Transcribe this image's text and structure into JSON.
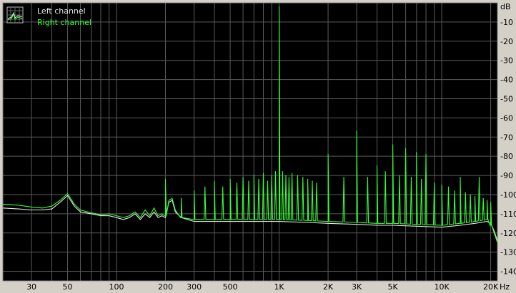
{
  "chart_data": {
    "type": "line",
    "title": "",
    "xlabel": "Hz",
    "ylabel": "dB",
    "x_scale": "log",
    "xlim": [
      20,
      22000
    ],
    "ylim": [
      -145,
      0
    ],
    "grid": true,
    "legend_position": "top-left",
    "x_ticks": [
      {
        "value": 30,
        "label": "30"
      },
      {
        "value": 50,
        "label": "50"
      },
      {
        "value": 100,
        "label": "100"
      },
      {
        "value": 200,
        "label": "200"
      },
      {
        "value": 300,
        "label": "300"
      },
      {
        "value": 500,
        "label": "500"
      },
      {
        "value": 1000,
        "label": "1K"
      },
      {
        "value": 2000,
        "label": "2K"
      },
      {
        "value": 3000,
        "label": "3K"
      },
      {
        "value": 5000,
        "label": "5K"
      },
      {
        "value": 10000,
        "label": "10K"
      },
      {
        "value": 20000,
        "label": "20K"
      }
    ],
    "y_ticks": [
      -10,
      -20,
      -30,
      -40,
      -50,
      -60,
      -70,
      -80,
      -90,
      -100,
      -110,
      -120,
      -130,
      -140
    ],
    "series": [
      {
        "name": "Left channel",
        "color": "#e8e8e8",
        "points": [
          [
            20,
            -107
          ],
          [
            25,
            -107.5
          ],
          [
            30,
            -108
          ],
          [
            35,
            -108
          ],
          [
            40,
            -107.5
          ],
          [
            45,
            -104
          ],
          [
            50,
            -100.5
          ],
          [
            55,
            -106
          ],
          [
            60,
            -109
          ],
          [
            70,
            -110
          ],
          [
            80,
            -111
          ],
          [
            90,
            -111
          ],
          [
            100,
            -112
          ],
          [
            110,
            -113
          ],
          [
            120,
            -112
          ],
          [
            130,
            -110
          ],
          [
            140,
            -113
          ],
          [
            150,
            -110
          ],
          [
            160,
            -112
          ],
          [
            170,
            -109
          ],
          [
            180,
            -112
          ],
          [
            190,
            -111
          ],
          [
            200,
            -112
          ],
          [
            210,
            -104
          ],
          [
            220,
            -103
          ],
          [
            230,
            -109
          ],
          [
            250,
            -112
          ],
          [
            300,
            -114
          ],
          [
            400,
            -114
          ],
          [
            500,
            -114
          ],
          [
            700,
            -114
          ],
          [
            1000,
            -114
          ],
          [
            1500,
            -114.5
          ],
          [
            2000,
            -115
          ],
          [
            3000,
            -115.5
          ],
          [
            4000,
            -116
          ],
          [
            5000,
            -116
          ],
          [
            7000,
            -116.5
          ],
          [
            10000,
            -117
          ],
          [
            13000,
            -116
          ],
          [
            16000,
            -115
          ],
          [
            19000,
            -114
          ],
          [
            20000,
            -115
          ],
          [
            21000,
            -119
          ],
          [
            22000,
            -124
          ]
        ]
      },
      {
        "name": "Right channel",
        "color": "#33ff33",
        "points": [
          [
            20,
            -105
          ],
          [
            25,
            -105.5
          ],
          [
            30,
            -106.5
          ],
          [
            35,
            -107
          ],
          [
            40,
            -106
          ],
          [
            45,
            -103
          ],
          [
            50,
            -99.5
          ],
          [
            55,
            -105
          ],
          [
            60,
            -108
          ],
          [
            70,
            -109.5
          ],
          [
            80,
            -110.5
          ],
          [
            90,
            -110
          ],
          [
            100,
            -111
          ],
          [
            110,
            -112
          ],
          [
            120,
            -111
          ],
          [
            130,
            -109
          ],
          [
            140,
            -112
          ],
          [
            150,
            -108
          ],
          [
            160,
            -111
          ],
          [
            170,
            -107
          ],
          [
            180,
            -111
          ],
          [
            190,
            -110
          ],
          [
            200,
            -111
          ],
          [
            210,
            -103
          ],
          [
            220,
            -102
          ],
          [
            230,
            -108
          ],
          [
            250,
            -112
          ],
          [
            300,
            -113
          ],
          [
            400,
            -113
          ],
          [
            500,
            -113
          ],
          [
            700,
            -113
          ],
          [
            1000,
            -113
          ],
          [
            1500,
            -113.5
          ],
          [
            2000,
            -114
          ],
          [
            3000,
            -114.5
          ],
          [
            4000,
            -115
          ],
          [
            5000,
            -115
          ],
          [
            7000,
            -115.5
          ],
          [
            10000,
            -116
          ],
          [
            13000,
            -115
          ],
          [
            16000,
            -114
          ],
          [
            19000,
            -113
          ],
          [
            20000,
            -116
          ],
          [
            21000,
            -120
          ],
          [
            22000,
            -125
          ]
        ],
        "peaks": [
          [
            200,
            -92
          ],
          [
            250,
            -102
          ],
          [
            300,
            -98
          ],
          [
            350,
            -96
          ],
          [
            400,
            -93
          ],
          [
            450,
            -96
          ],
          [
            500,
            -92
          ],
          [
            550,
            -94
          ],
          [
            600,
            -91
          ],
          [
            650,
            -93
          ],
          [
            700,
            -90
          ],
          [
            750,
            -92
          ],
          [
            800,
            -89
          ],
          [
            850,
            -93
          ],
          [
            900,
            -90
          ],
          [
            950,
            -88
          ],
          [
            1000,
            -2
          ],
          [
            1050,
            -88
          ],
          [
            1100,
            -90
          ],
          [
            1150,
            -91
          ],
          [
            1200,
            -89
          ],
          [
            1300,
            -90
          ],
          [
            1400,
            -91
          ],
          [
            1500,
            -92
          ],
          [
            1600,
            -93
          ],
          [
            1700,
            -94
          ],
          [
            2000,
            -79
          ],
          [
            2500,
            -91
          ],
          [
            3000,
            -67
          ],
          [
            3500,
            -91
          ],
          [
            4000,
            -85
          ],
          [
            4500,
            -88
          ],
          [
            5000,
            -74
          ],
          [
            5500,
            -90
          ],
          [
            6000,
            -76
          ],
          [
            6500,
            -91
          ],
          [
            7000,
            -78
          ],
          [
            7500,
            -92
          ],
          [
            8000,
            -79
          ],
          [
            9000,
            -94
          ],
          [
            10000,
            -95
          ],
          [
            11000,
            -96
          ],
          [
            12000,
            -98
          ],
          [
            13000,
            -91
          ],
          [
            14000,
            -99
          ],
          [
            15000,
            -100
          ],
          [
            16000,
            -101
          ],
          [
            17000,
            -91
          ],
          [
            18000,
            -102
          ],
          [
            19000,
            -103
          ],
          [
            20000,
            -104
          ]
        ]
      }
    ]
  },
  "legend": {
    "icon": "spectrum-grid-icon",
    "items": [
      {
        "label": "Left channel",
        "color": "#e8e8e8"
      },
      {
        "label": "Right channel",
        "color": "#33ff33"
      }
    ]
  }
}
